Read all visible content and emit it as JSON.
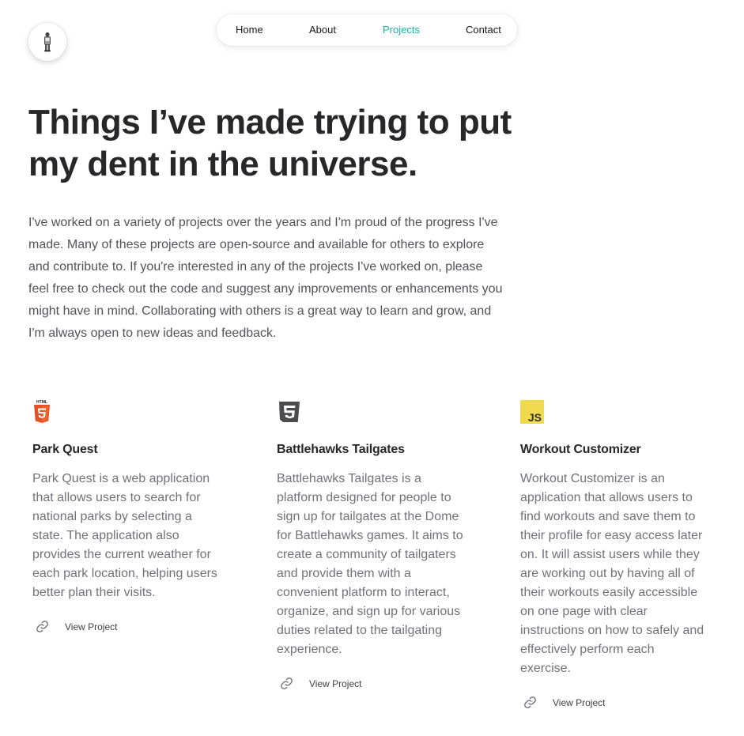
{
  "nav": {
    "items": [
      {
        "label": "Home"
      },
      {
        "label": "About"
      },
      {
        "label": "Projects",
        "active": true
      },
      {
        "label": "Contact"
      }
    ]
  },
  "avatar": {
    "icon": "person-figure-icon"
  },
  "hero": {
    "title": "Things I’ve made trying to put my dent in the universe.",
    "intro": "I've worked on a variety of projects over the years and I'm proud of the progress I've made. Many of these projects are open-source and available for others to explore and contribute to. If you're interested in any of the projects I've worked on, please feel free to check out the code and suggest any improvements or enhancements you might have in mind. Collaborating with others is a great way to learn and grow, and I'm always open to new ideas and feedback."
  },
  "projects": [
    {
      "icon": "html5-icon",
      "icon_label": "HTML",
      "title": "Park Quest",
      "description": "Park Quest is a web application that allows users to search for national parks by selecting a state. The application also provides the current weather for each park location, helping users better plan their visits.",
      "link_label": "View Project"
    },
    {
      "icon": "css3-icon",
      "title": "Battlehawks Tailgates",
      "description": "Battlehawks Tailgates is a platform designed for people to sign up for tailgates at the Dome for Battlehawks games. It aims to create a community of tailgaters and provide them with a convenient platform to interact, organize, and sign up for various duties related to the tailgating experience.",
      "link_label": "View Project"
    },
    {
      "icon": "javascript-icon",
      "icon_label": "JS",
      "title": "Workout Customizer",
      "description": "Workout Customizer is an application that allows users to find workouts and save them to their profile for easy access later on. It will assist users while they are working out by having all of their workouts easily accessible on one page with clear instructions on how to safely and effectively perform each exercise.",
      "link_label": "View Project"
    }
  ],
  "colors": {
    "accent": "#14b8a6",
    "heading": "#27272a",
    "body_text": "#52525b",
    "muted_text": "#71717a",
    "html5": "#e34f26",
    "css3": "#4b4b4d",
    "js": "#f0db4f"
  }
}
